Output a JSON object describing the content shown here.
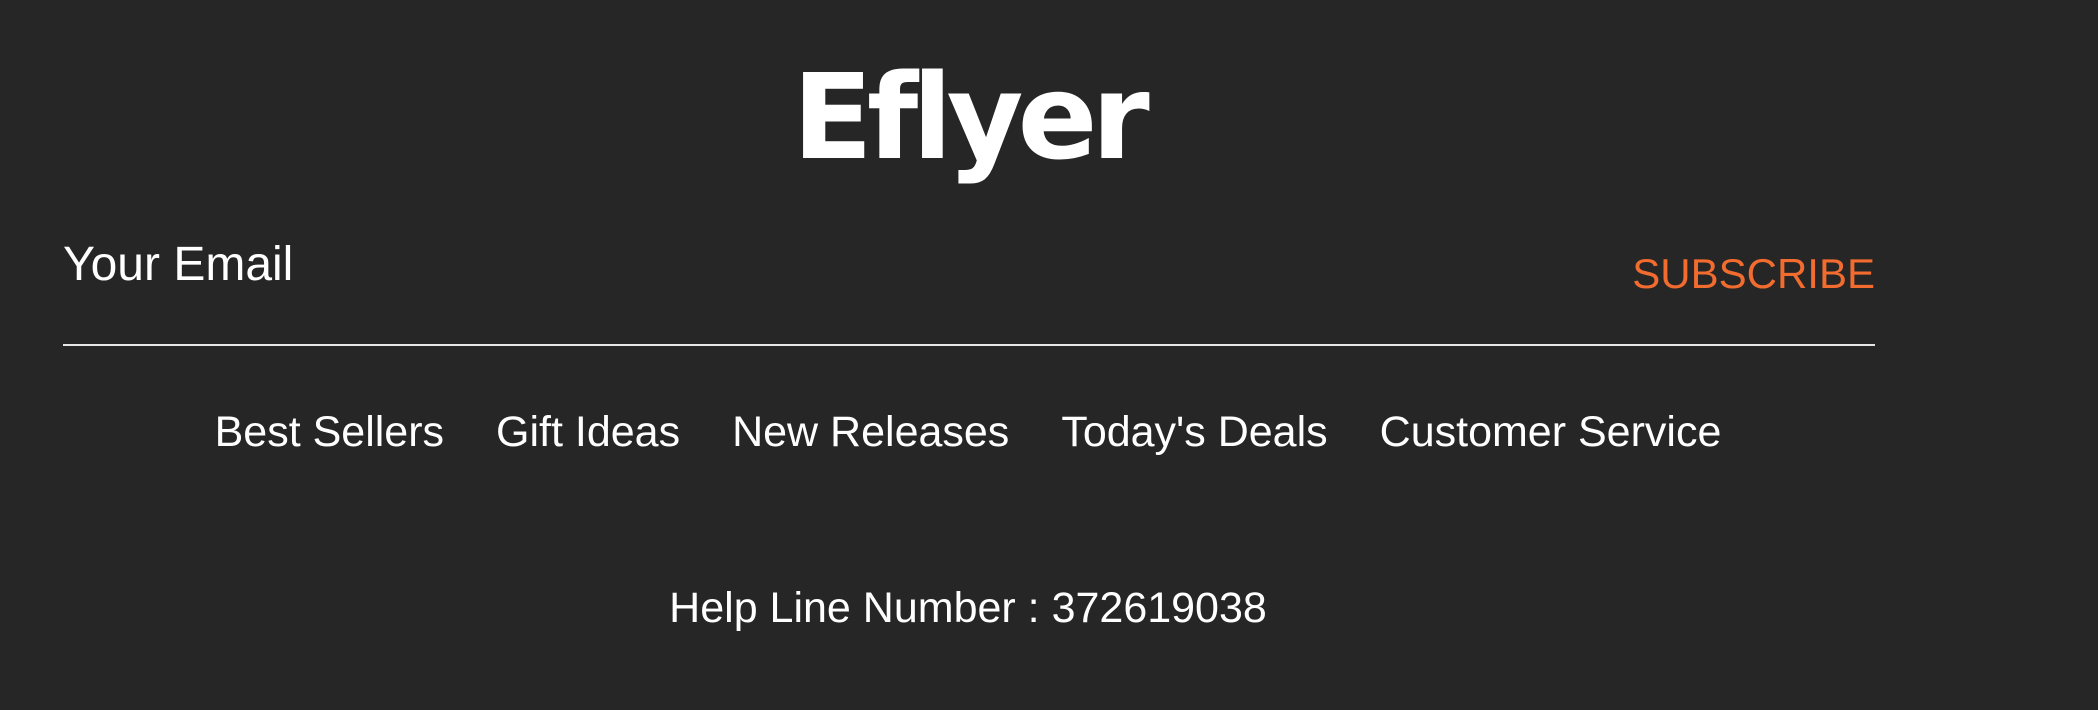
{
  "logo": {
    "text": "Eflyer"
  },
  "newsletter": {
    "email_placeholder": "Your Email",
    "subscribe_label": "SUBSCRIBE"
  },
  "nav": {
    "items": [
      {
        "label": "Best Sellers"
      },
      {
        "label": "Gift Ideas"
      },
      {
        "label": "New Releases"
      },
      {
        "label": "Today's Deals"
      },
      {
        "label": "Customer Service"
      }
    ]
  },
  "footer": {
    "helpline": "Help Line Number : 372619038"
  },
  "colors": {
    "background": "#262626",
    "accent": "#f26b2f",
    "text": "#ffffff"
  }
}
